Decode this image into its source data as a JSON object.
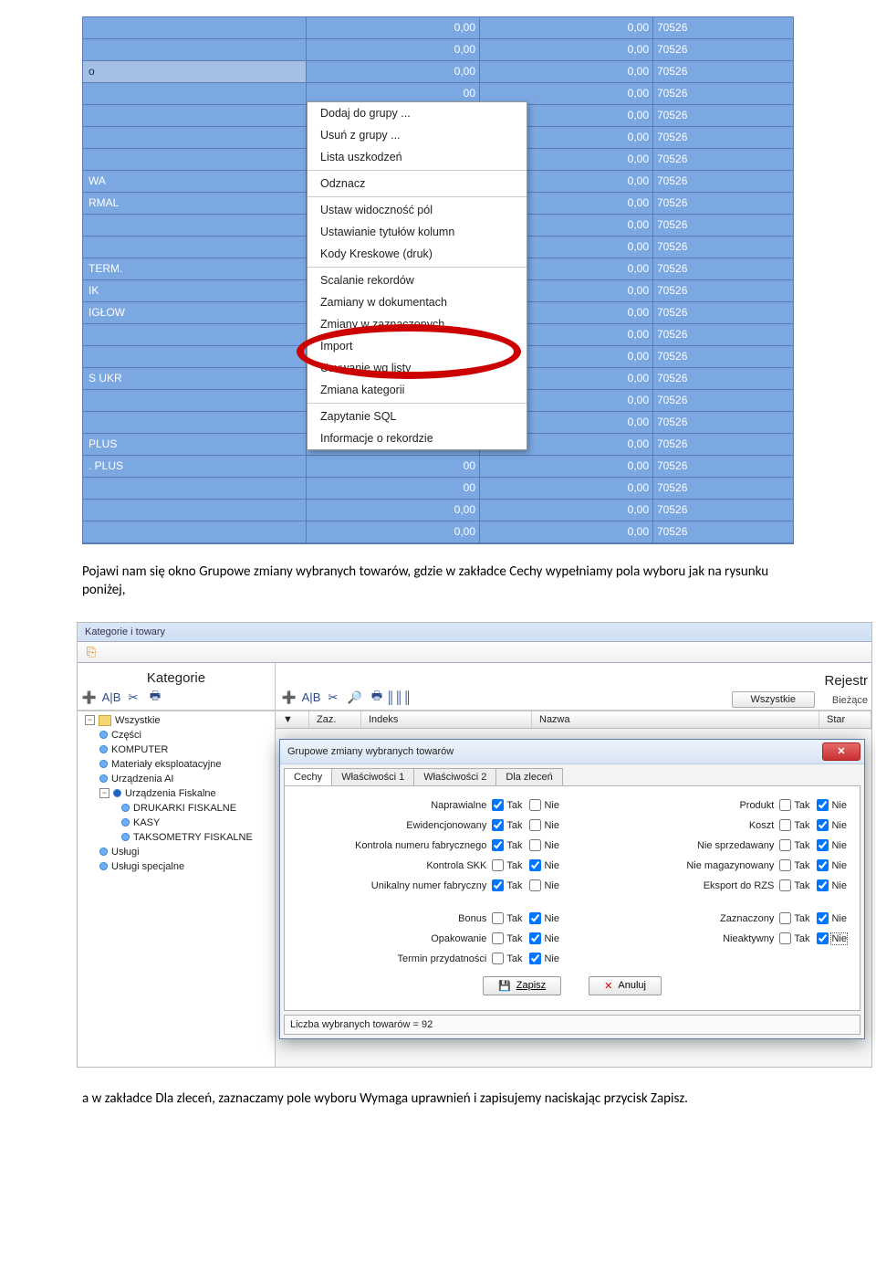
{
  "shot1": {
    "left_rows": [
      "",
      "",
      "o",
      "",
      "",
      "",
      "",
      "WA",
      "RMAL",
      "",
      "",
      " TERM.",
      "IK",
      " IGŁOW",
      "",
      "",
      "S UKR",
      "",
      "",
      "PLUS",
      ". PLUS",
      "",
      "",
      ""
    ],
    "sel_index": 2,
    "data_row": {
      "c1": "0,00",
      "c2": "0,00",
      "c3": "70526"
    },
    "data_row_alt": {
      "c1": "00",
      "c2": "0,00",
      "c3": "70526"
    },
    "menu": {
      "groups": [
        [
          "Dodaj do grupy ...",
          "Usuń z grupy ...",
          "Lista uszkodzeń"
        ],
        [
          "Odznacz"
        ],
        [
          "Ustaw widoczność pól",
          "Ustawianie tytułów kolumn",
          "Kody Kreskowe (druk)"
        ],
        [
          "Scalanie rekordów",
          "Zamiany w dokumentach",
          "Zmiany w zaznaczonych",
          "Import",
          "Usuwanie wg listy",
          "Zmiana kategorii"
        ],
        [
          "Zapytanie SQL",
          "Informacje o rekordzie"
        ]
      ]
    }
  },
  "para1": "Pojawi nam się okno Grupowe zmiany wybranych towarów, gdzie w zakładce Cechy wypełniamy pola wyboru jak na rysunku poniżej,",
  "shot2": {
    "app_label": "Kategorie i towary",
    "panel_kat": "Kategorie",
    "panel_rej": "Rejestr",
    "btn_wszystkie": "Wszystkie",
    "lbl_biezace": "Bieżące",
    "grid_headers": {
      "zaz": "Zaz.",
      "indeks": "Indeks",
      "nazwa": "Nazwa",
      "star": "Star"
    },
    "tree": [
      {
        "t": "Wszystkie",
        "lvl": 1,
        "kind": "folder",
        "pm": "-"
      },
      {
        "t": "Części",
        "lvl": 2,
        "kind": "dot"
      },
      {
        "t": "KOMPUTER",
        "lvl": 2,
        "kind": "dot"
      },
      {
        "t": "Materiały eksploatacyjne",
        "lvl": 2,
        "kind": "dot"
      },
      {
        "t": "Urządzenia AI",
        "lvl": 2,
        "kind": "dot"
      },
      {
        "t": "Urządzenia Fiskalne",
        "lvl": 2,
        "kind": "dotsel",
        "pm": "-"
      },
      {
        "t": "DRUKARKI FISKALNE",
        "lvl": 3,
        "kind": "dot"
      },
      {
        "t": "KASY",
        "lvl": 3,
        "kind": "dot"
      },
      {
        "t": "TAKSOMETRY FISKALNE",
        "lvl": 3,
        "kind": "dot"
      },
      {
        "t": "Usługi",
        "lvl": 2,
        "kind": "dot"
      },
      {
        "t": "Usługi specjalne",
        "lvl": 2,
        "kind": "dot"
      }
    ],
    "dlg": {
      "title": "Grupowe zmiany wybranych towarów",
      "tabs": [
        "Cechy",
        "Właściwości 1",
        "Właściwości 2",
        "Dla zleceń"
      ],
      "active_tab": 0,
      "tak": "Tak",
      "nie": "Nie",
      "left_rows": [
        {
          "label": "Naprawialne",
          "tak": true,
          "nie": false
        },
        {
          "label": "Ewidencjonowany",
          "tak": true,
          "nie": false
        },
        {
          "label": "Kontrola numeru fabrycznego",
          "tak": true,
          "nie": false
        },
        {
          "label": "Kontrola SKK",
          "tak": false,
          "nie": true
        },
        {
          "label": "Unikalny numer fabryczny",
          "tak": true,
          "nie": false
        }
      ],
      "left_rows2": [
        {
          "label": "Bonus",
          "tak": false,
          "nie": true
        },
        {
          "label": "Opakowanie",
          "tak": false,
          "nie": true
        },
        {
          "label": "Termin przydatności",
          "tak": false,
          "nie": true
        }
      ],
      "right_rows": [
        {
          "label": "Produkt",
          "tak": false,
          "nie": true
        },
        {
          "label": "Koszt",
          "tak": false,
          "nie": true
        },
        {
          "label": "Nie sprzedawany",
          "tak": false,
          "nie": true
        },
        {
          "label": "Nie magazynowany",
          "tak": false,
          "nie": true
        },
        {
          "label": "Eksport do RZS",
          "tak": false,
          "nie": true
        }
      ],
      "right_rows2": [
        {
          "label": "Zaznaczony",
          "tak": false,
          "nie": true
        },
        {
          "label": "Nieaktywny",
          "tak": false,
          "nie": true,
          "focus": true
        }
      ],
      "btn_zapisz": "Zapisz",
      "btn_anuluj": "Anuluj",
      "status": "Liczba wybranych towarów = 92"
    }
  },
  "para2": "a w zakładce Dla zleceń, zaznaczamy pole wyboru Wymaga uprawnień i zapisujemy naciskając przycisk Zapisz."
}
